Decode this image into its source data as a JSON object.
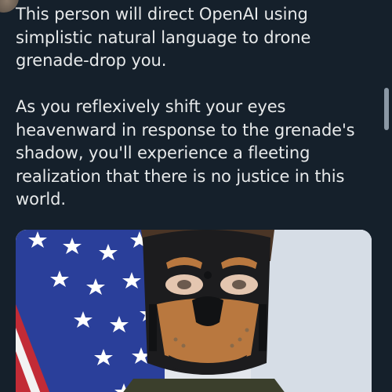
{
  "tweet": {
    "paragraphs": [
      "This person will direct OpenAI using simplistic natural language to drone grenade-drop you.",
      "As you reflexively shift your eyes heavenward in response to the grenade's shadow, you'll experience a fleeting realization that there is no justice in this world."
    ]
  },
  "media": {
    "subject": "person in a pup-style mask in front of an American flag",
    "colors": {
      "flag_blue": "#2a3f9a",
      "flag_red": "#c22b36",
      "mask_black": "#1c1c1e",
      "mask_tan": "#b9783f",
      "background": "#dfe4ea"
    }
  },
  "ui": {
    "background": "#15202b",
    "text_color": "#e7e9ea",
    "scrollbar_color": "#8b98a5"
  }
}
